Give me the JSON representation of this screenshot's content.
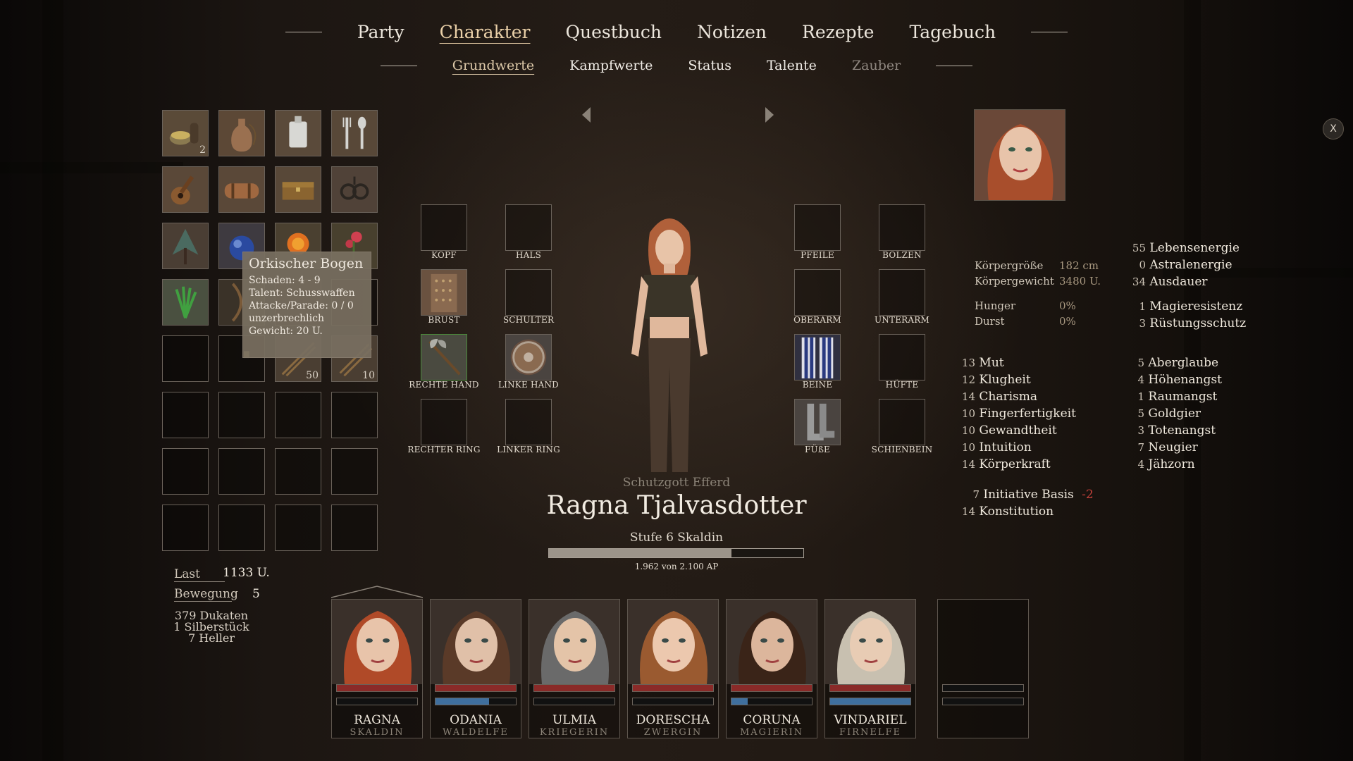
{
  "nav": {
    "tabs": [
      "Party",
      "Charakter",
      "Questbuch",
      "Notizen",
      "Rezepte",
      "Tagebuch"
    ],
    "active": "Charakter"
  },
  "subnav": {
    "tabs": [
      "Grundwerte",
      "Kampfwerte",
      "Status",
      "Talente",
      "Zauber"
    ],
    "active": "Grundwerte",
    "disabled": "Zauber"
  },
  "inventory": {
    "counts": {
      "slot0": "2",
      "slot14": "50",
      "slot15": "10"
    }
  },
  "tooltip": {
    "title": "Orkischer Bogen",
    "lines": [
      "Schaden: 4 - 9",
      "Talent: Schusswaffen",
      "Attacke/Parade: 0 / 0",
      "unzerbrechlich",
      "Gewicht: 20 U."
    ]
  },
  "equipment": {
    "labels": [
      "KOPF",
      "HALS",
      "PFEILE",
      "BOLZEN",
      "BRUST",
      "SCHULTER",
      "OBERARM",
      "UNTERARM",
      "RECHTE HAND",
      "LINKE HAND",
      "BEINE",
      "HÜFTE",
      "RECHTER RING",
      "LINKER RING",
      "FÜßE",
      "SCHIENBEIN"
    ]
  },
  "character": {
    "deity": "Schutzgott Efferd",
    "name": "Ragna Tjalvasdotter",
    "level": "Stufe 6 Skaldin",
    "xp_text": "1.962 von 2.100 AP",
    "xp_current": 1962,
    "xp_max": 2100
  },
  "body": {
    "height_label": "Körpergröße",
    "height": "182 cm",
    "weight_label": "Körpergewicht",
    "weight": "3480 U.",
    "hunger_label": "Hunger",
    "hunger": "0%",
    "thirst_label": "Durst",
    "thirst": "0%"
  },
  "energy": [
    {
      "v": "55",
      "l": "Lebensenergie"
    },
    {
      "v": "0",
      "l": "Astralenergie"
    },
    {
      "v": "34",
      "l": "Ausdauer"
    },
    {
      "v": "1",
      "l": "Magieresistenz"
    },
    {
      "v": "3",
      "l": "Rüstungsschutz"
    }
  ],
  "attributes": [
    {
      "v": "13",
      "l": "Mut"
    },
    {
      "v": "12",
      "l": "Klugheit"
    },
    {
      "v": "14",
      "l": "Charisma"
    },
    {
      "v": "10",
      "l": "Fingerfertigkeit"
    },
    {
      "v": "10",
      "l": "Gewandtheit"
    },
    {
      "v": "10",
      "l": "Intuition"
    },
    {
      "v": "14",
      "l": "Körperkraft"
    }
  ],
  "negative": [
    {
      "v": "5",
      "l": "Aberglaube"
    },
    {
      "v": "4",
      "l": "Höhenangst"
    },
    {
      "v": "1",
      "l": "Raumangst"
    },
    {
      "v": "5",
      "l": "Goldgier"
    },
    {
      "v": "3",
      "l": "Totenangst"
    },
    {
      "v": "7",
      "l": "Neugier"
    },
    {
      "v": "4",
      "l": "Jähzorn"
    }
  ],
  "derived": {
    "init_v": "7",
    "init_l": "Initiative Basis",
    "init_mod": "-2",
    "kon_v": "14",
    "kon_l": "Konstitution"
  },
  "load": {
    "last_label": "Last",
    "last": "1133 U.",
    "move_label": "Bewegung",
    "move": "5",
    "money": [
      "379 Dukaten",
      "1 Silberstück",
      "7 Heller"
    ]
  },
  "close_label": "X",
  "party": [
    {
      "name": "RAGNA",
      "cls": "SKALDIN",
      "hp": 1.0,
      "ae": 0
    },
    {
      "name": "ODANIA",
      "cls": "WALDELFE",
      "hp": 1.0,
      "ae": 0.67
    },
    {
      "name": "ULMIA",
      "cls": "KRIEGERIN",
      "hp": 1.0,
      "ae": 0
    },
    {
      "name": "DORESCHA",
      "cls": "ZWERGIN",
      "hp": 1.0,
      "ae": 0
    },
    {
      "name": "CORUNA",
      "cls": "MAGIERIN",
      "hp": 1.0,
      "ae": 0.2
    },
    {
      "name": "VINDARIEL",
      "cls": "FIRNELFE",
      "hp": 1.0,
      "ae": 1.0
    }
  ],
  "colors": {
    "hp": "#8a2a28",
    "ae": "#3f6f9e",
    "accent": "#ead0a8",
    "negative": "#c0403a"
  }
}
